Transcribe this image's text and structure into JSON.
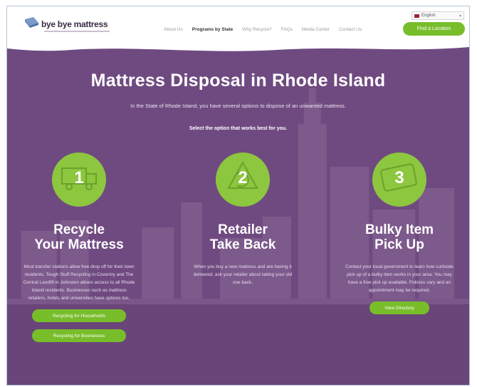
{
  "header": {
    "logo_text": "bye bye mattress",
    "language": "English",
    "nav": [
      {
        "label": "About Us",
        "active": false
      },
      {
        "label": "Programs by State",
        "active": true
      },
      {
        "label": "Why Recycle?",
        "active": false
      },
      {
        "label": "FAQs",
        "active": false
      },
      {
        "label": "Media Center",
        "active": false
      },
      {
        "label": "Contact Us",
        "active": false
      }
    ],
    "cta_label": "Find a Location"
  },
  "hero": {
    "title": "Mattress Disposal in Rhode Island",
    "intro": "In the State of Rhode Island, you have several options to dispose of an unwanted mattress.",
    "select_prompt": "Select the option that works best for you."
  },
  "options": [
    {
      "number": "1",
      "heading_line1": "Recycle",
      "heading_line2": "Your Mattress",
      "description": "Most transfer stations allow free drop off for their town residents. Tough Stuff Recycling in Coventry and The Central Landfill in Johnston allows access to all Rhode Island residents. Businesses such as mattress retailers, hotels and universities have options too.",
      "buttons": [
        "Recycling for Households",
        "Recycling for Businesses"
      ]
    },
    {
      "number": "2",
      "heading_line1": "Retailer",
      "heading_line2": "Take Back",
      "description": "When you buy a new mattress and are having it delivered, ask your retailer about taking your old one back.",
      "buttons": []
    },
    {
      "number": "3",
      "heading_line1": "Bulky Item",
      "heading_line2": "Pick Up",
      "description": "Contact your local government to learn how curbside pick up of a bulky item works in your area. You may have a free pick up available. Policies vary and an appointment may be required.",
      "buttons": [
        "View Directory"
      ]
    }
  ],
  "colors": {
    "purple": "#6f4a80",
    "green": "#78bd2a",
    "circle_green": "#8dc63f"
  }
}
